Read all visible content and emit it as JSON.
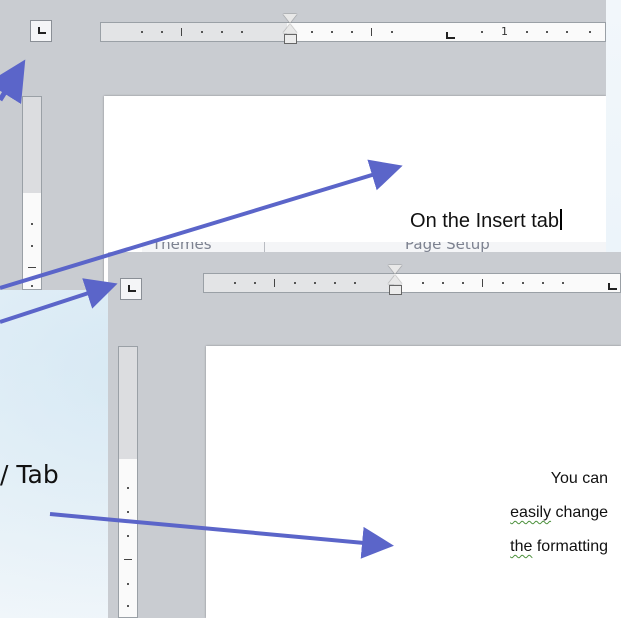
{
  "screenshot_top": {
    "ruler_number": "1",
    "document_text": "On the Insert tab",
    "ribbon_labels": [
      "Themes",
      "Page Setup"
    ]
  },
  "screenshot_bottom": {
    "document_lines": [
      "You can",
      "easily change",
      "the formatting"
    ],
    "underlined_words": [
      "easily",
      "the"
    ]
  },
  "caption": {
    "text": "/ Tab"
  },
  "colors": {
    "arrow": "#5b65c9",
    "squiggle": "#4a8f3a"
  },
  "icons": {
    "tab_selector_top": "left-tab-stop-icon",
    "tab_selector_bottom": "left-tab-stop-icon"
  }
}
